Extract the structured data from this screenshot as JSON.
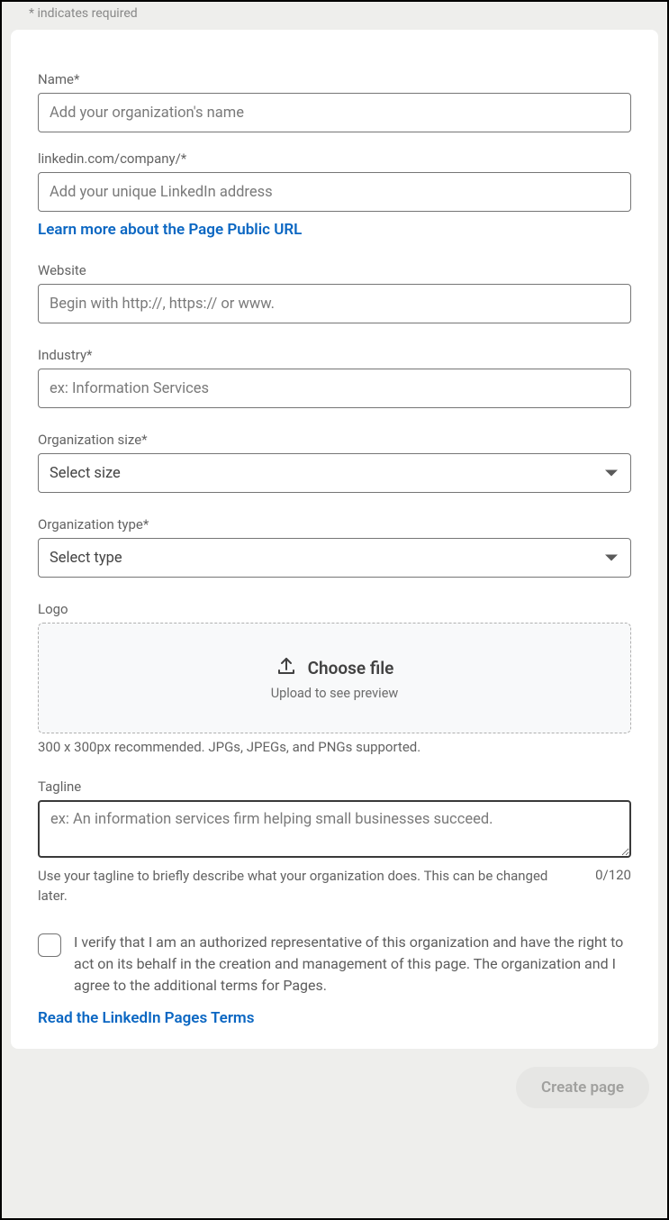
{
  "requiredNote": "*  indicates required",
  "fields": {
    "name": {
      "label": "Name*",
      "placeholder": "Add your organization's name"
    },
    "url": {
      "label": "linkedin.com/company/*",
      "placeholder": "Add your unique LinkedIn address",
      "learnMore": "Learn more about the Page Public URL"
    },
    "website": {
      "label": "Website",
      "placeholder": "Begin with http://, https:// or www."
    },
    "industry": {
      "label": "Industry*",
      "placeholder": "ex: Information Services"
    },
    "orgSize": {
      "label": "Organization size*",
      "selected": "Select size"
    },
    "orgType": {
      "label": "Organization type*",
      "selected": "Select type"
    },
    "logo": {
      "label": "Logo",
      "choose": "Choose file",
      "preview": "Upload to see preview",
      "hint": "300 x 300px recommended. JPGs, JPEGs, and PNGs supported."
    },
    "tagline": {
      "label": "Tagline",
      "placeholder": "ex: An information services firm helping small businesses succeed.",
      "hint": "Use your tagline to briefly describe what your organization does. This can be changed later.",
      "count": "0/120"
    }
  },
  "verify": {
    "text": "I verify that I am an authorized representative of this organization and have the right to act on its behalf in the creation and management of this page. The organization and I agree to the additional terms for Pages."
  },
  "termsLink": "Read the LinkedIn Pages Terms",
  "createButton": "Create page"
}
